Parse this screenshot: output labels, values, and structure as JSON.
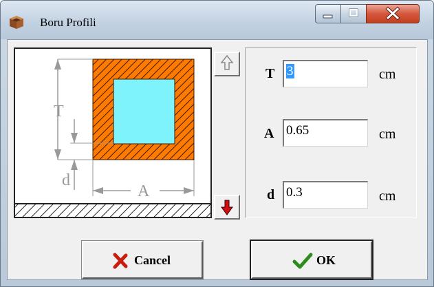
{
  "window": {
    "title": "Boru Profili",
    "icon": "profile-icon",
    "controls": [
      "minimize-icon",
      "maximize-icon",
      "close-icon"
    ]
  },
  "diagram": {
    "labels": {
      "t": "T",
      "d": "d",
      "a": "A"
    },
    "fill_colors": {
      "inner": "#7ff3fb",
      "wall": "#ff7a00",
      "hatch": "#3a1a00"
    }
  },
  "steppers": {
    "up_icon": "arrow-up-icon",
    "down_icon": "arrow-down-icon"
  },
  "fields": [
    {
      "label": "T",
      "value": "3",
      "unit": "cm",
      "selected": true
    },
    {
      "label": "A",
      "value": "0.65",
      "unit": "cm",
      "selected": false
    },
    {
      "label": "d",
      "value": "0.3",
      "unit": "cm",
      "selected": false
    }
  ],
  "buttons": {
    "cancel": {
      "label": "Cancel",
      "icon": "x-icon"
    },
    "ok": {
      "label": "OK",
      "icon": "checkmark-icon"
    }
  },
  "colors": {
    "cancel_icon": "#c81e10",
    "ok_icon": "#2e8b1e",
    "down_arrow": "#d01010",
    "selection": "#3399ff"
  }
}
